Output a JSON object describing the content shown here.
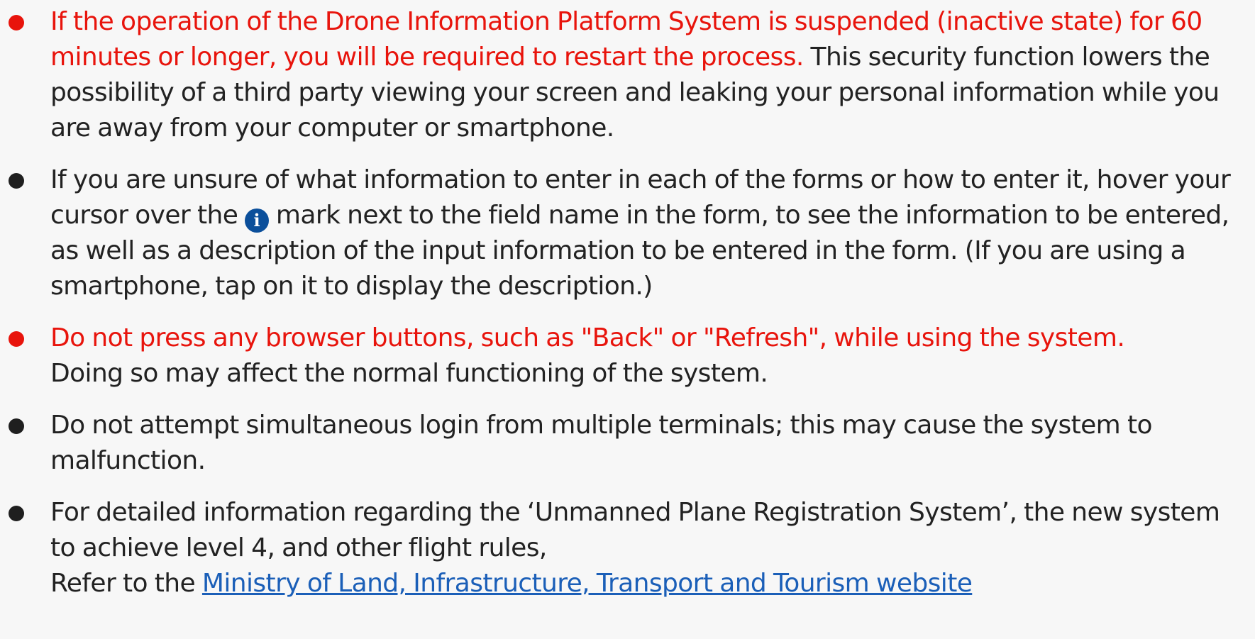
{
  "icons": {
    "bullet": "bullet-dot",
    "info": "info-circle-icon",
    "info_glyph": "i"
  },
  "colors": {
    "warning_red": "#e8140c",
    "info_blue": "#0b4f9b",
    "link_blue": "#1b5fb8",
    "background": "#f7f7f7"
  },
  "notices": {
    "n1": {
      "red": "If the operation of the Drone Information Platform System is suspended (inactive state) for 60 minutes or longer, you will be required to restart the process.",
      "normal": " This security function lowers the possibility of a third party viewing your screen and leaking your personal information while you are away from your computer or smartphone."
    },
    "n2": {
      "before": "If you are unsure of what information to enter in each of the forms or how to enter it, hover your cursor over the ",
      "after": " mark next to the field name in the form, to see the information to be entered, as well as a description of the input information to be entered in the form. (If you are using a smartphone, tap on it to display the description.)"
    },
    "n3": {
      "red": "Do not press any browser buttons, such as \"Back\" or \"Refresh\", while using the system.",
      "normal": "Doing so may affect the normal functioning of the system."
    },
    "n4": {
      "text": "Do not attempt simultaneous login from multiple terminals; this may cause the system to malfunction."
    },
    "n5": {
      "line1": "For detailed information regarding the ‘Unmanned Plane Registration System’, the new system to achieve level 4, and other flight rules,",
      "line2_prefix": "Refer to the ",
      "link": "Ministry of Land, Infrastructure, Transport and Tourism website"
    }
  }
}
